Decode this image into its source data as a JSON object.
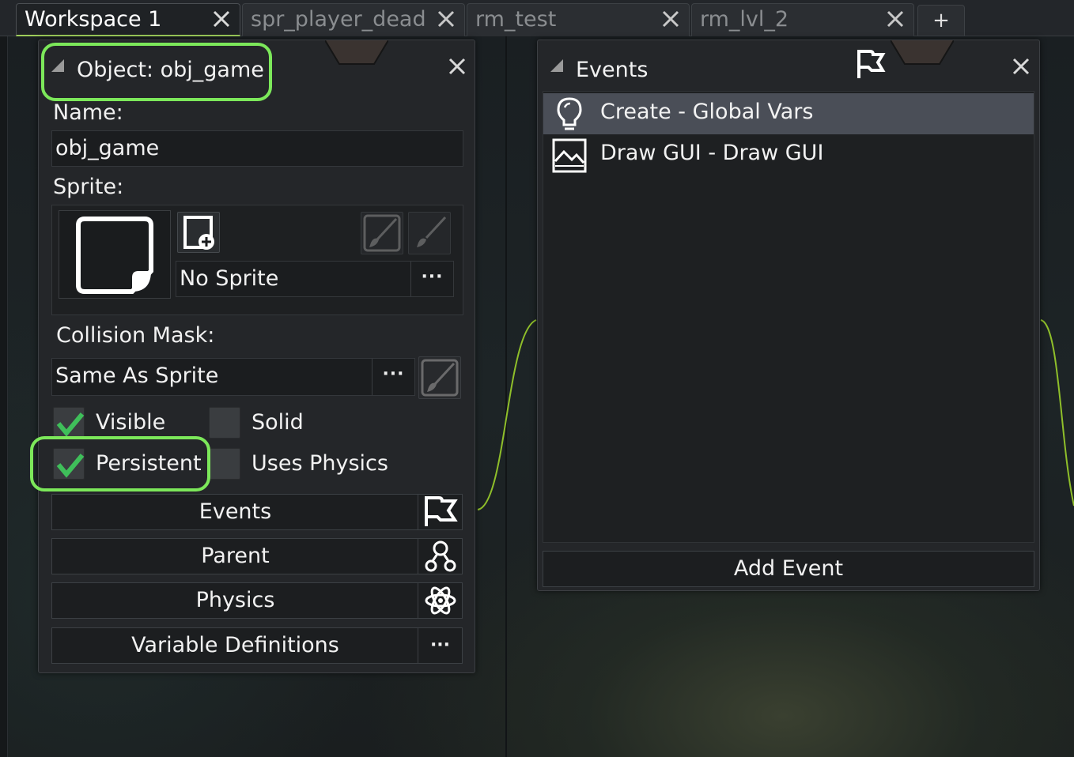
{
  "tabs": [
    {
      "label": "Workspace 1",
      "active": true
    },
    {
      "label": "spr_player_dead",
      "active": false
    },
    {
      "label": "rm_test",
      "active": false
    },
    {
      "label": "rm_lvl_2",
      "active": false
    }
  ],
  "tab_add_label": "+",
  "object_panel": {
    "title": "Object: obj_game",
    "name_label": "Name:",
    "name_value": "obj_game",
    "sprite_label": "Sprite:",
    "sprite_value": "No Sprite",
    "dots": "···",
    "collision_label": "Collision Mask:",
    "collision_value": "Same As Sprite",
    "checkboxes": {
      "visible": {
        "label": "Visible",
        "checked": true
      },
      "solid": {
        "label": "Solid",
        "checked": false
      },
      "persistent": {
        "label": "Persistent",
        "checked": true
      },
      "uses_physics": {
        "label": "Uses Physics",
        "checked": false
      }
    },
    "buttons": {
      "events": "Events",
      "parent": "Parent",
      "physics": "Physics",
      "variable_definitions": "Variable Definitions"
    }
  },
  "events_panel": {
    "title": "Events",
    "events": [
      {
        "label": "Create - Global Vars",
        "icon": "lightbulb-icon",
        "selected": true
      },
      {
        "label": "Draw GUI - Draw GUI",
        "icon": "image-icon",
        "selected": false
      }
    ],
    "add_event_label": "Add Event"
  },
  "colors": {
    "highlight": "#7ce85a",
    "check_green": "#3fbf5a",
    "connector_green": "#8fbf2a",
    "selected_row": "#4a4e57"
  }
}
